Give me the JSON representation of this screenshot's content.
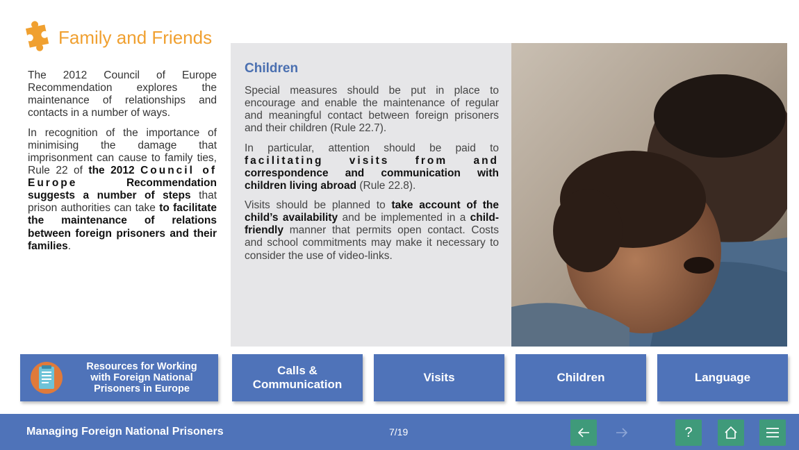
{
  "page": {
    "title": "Family and Friends",
    "title_color": "#f0a030",
    "title_icon": "puzzle-icon"
  },
  "intro": {
    "p1": "The 2012 Council of Europe Recommendation explores the maintenance of relationships and contacts in a number of ways.",
    "p2_a": "In recognition of the importance of minimising the damage that imprisonment can cause to family ties, Rule 22 of ",
    "p2_b": "the 2012",
    "p2_c": "Council of Europe",
    "p2_d": "Recommendation suggests a number of steps",
    "p2_e": " that prison authorities can take ",
    "p2_f": "to facilitate the maintenance of relations between foreign prisoners and their families",
    "p2_g": "."
  },
  "children": {
    "heading": "Children",
    "heading_color": "#4a6fb0",
    "p1": "Special measures should be put in place to encourage and enable the maintenance of regular and meaningful contact between foreign prisoners and their children (Rule 22.7).",
    "p2_a": "In particular, attention should be paid to ",
    "p2_b": "facilitating visits from and",
    "p2_c": "correspondence and communication with children living abroad",
    "p2_d": " (Rule 22.8).",
    "p3_a": "Visits should be planned to ",
    "p3_b": "take account of the child’s availability",
    "p3_c": " and be implemented in a ",
    "p3_d": "child-friendly",
    "p3_e": " manner that permits open contact. Costs and school commitments may make it necessary to consider the use of video-links."
  },
  "nav": {
    "resources_label": "Resources for Working with Foreign National Prisoners in Europe",
    "calls_label": "Calls & Communication",
    "visits_label": "Visits",
    "children_label": "Children",
    "language_label": "Language",
    "button_color": "#4f73b9"
  },
  "footer": {
    "title": "Managing Foreign National Prisoners",
    "page_counter": "7/19",
    "back_icon": "arrow-left-icon",
    "forward_icon": "arrow-right-icon",
    "help_label": "?",
    "home_icon": "home-icon",
    "menu_icon": "menu-icon",
    "bar_color": "#4f73b9",
    "button_color": "#3f9a7a"
  }
}
